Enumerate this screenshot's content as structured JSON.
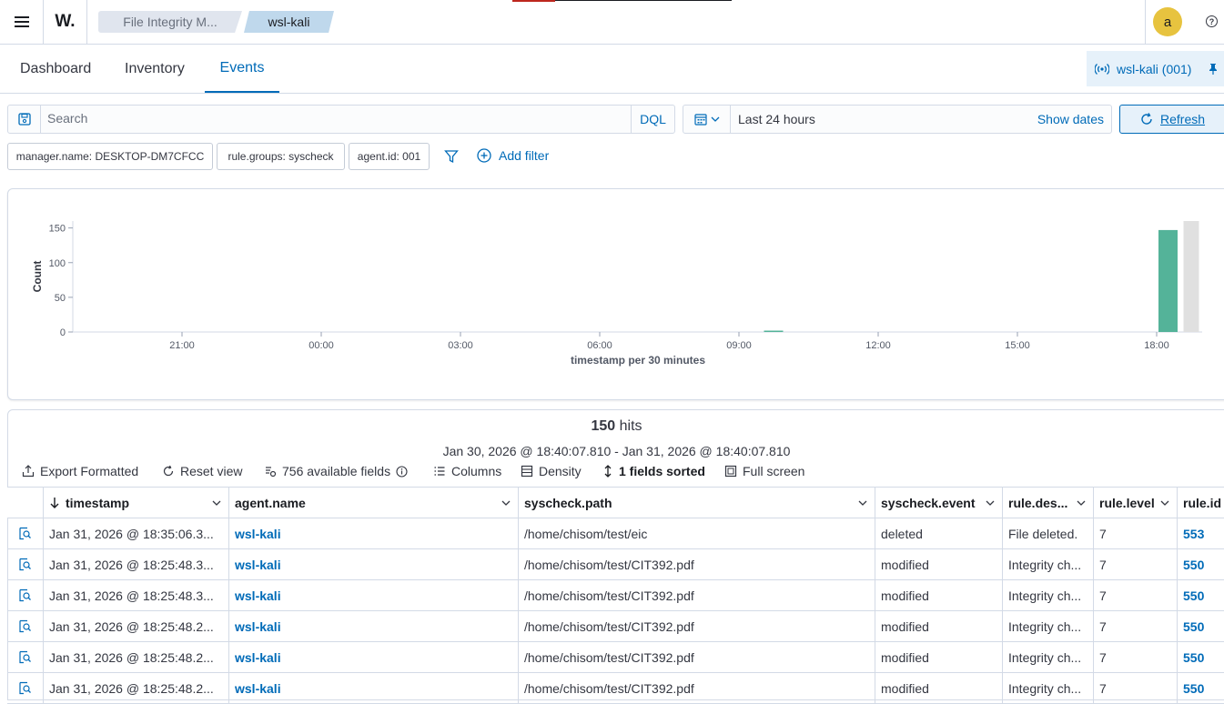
{
  "header": {
    "logo_text": "W.",
    "breadcrumbs": [
      "File Integrity M...",
      "wsl-kali"
    ],
    "avatar_initial": "a",
    "help_symbol": "?"
  },
  "nav": {
    "tabs": [
      "Dashboard",
      "Inventory",
      "Events"
    ],
    "active_tab": "Events",
    "agent_pill": "wsl-kali (001)"
  },
  "search": {
    "placeholder": "Search",
    "language": "DQL",
    "time_range": "Last 24 hours",
    "show_dates": "Show dates",
    "refresh": "Refresh"
  },
  "filters": {
    "pills": [
      "manager.name: DESKTOP-DM7CFCC",
      "rule.groups: syscheck",
      "agent.id: 001"
    ],
    "add_filter": "Add filter"
  },
  "chart_data": {
    "type": "bar",
    "ylabel": "Count",
    "xlabel": "timestamp per 30 minutes",
    "yticks": [
      "0",
      "50",
      "100",
      "150"
    ],
    "ylim": [
      0,
      160
    ],
    "xticks": [
      "21:00",
      "00:00",
      "03:00",
      "06:00",
      "09:00",
      "12:00",
      "15:00",
      "18:00"
    ],
    "x": [
      "09:30",
      "18:00",
      "18:30"
    ],
    "values": [
      1,
      147,
      0
    ],
    "bar_color": "#54b399",
    "highlight_color": "#e0e0e0"
  },
  "results": {
    "hits_count": "150",
    "hits_label": "hits",
    "date_range": "Jan 30, 2026 @ 18:40:07.810 - Jan 31, 2026 @ 18:40:07.810",
    "toolbar": {
      "export": "Export Formatted",
      "reset": "Reset view",
      "fields": "756 available fields",
      "columns": "Columns",
      "density": "Density",
      "sorted": "1 fields sorted",
      "fullscreen": "Full screen"
    }
  },
  "table": {
    "columns": [
      "timestamp",
      "agent.name",
      "syscheck.path",
      "syscheck.event",
      "rule.des...",
      "rule.level",
      "rule.id"
    ],
    "rows": [
      [
        "Jan 31, 2026 @ 18:35:06.3...",
        "wsl-kali",
        "/home/chisom/test/eic",
        "deleted",
        "File deleted.",
        "7",
        "553"
      ],
      [
        "Jan 31, 2026 @ 18:25:48.3...",
        "wsl-kali",
        "/home/chisom/test/CIT392.pdf",
        "modified",
        "Integrity ch...",
        "7",
        "550"
      ],
      [
        "Jan 31, 2026 @ 18:25:48.3...",
        "wsl-kali",
        "/home/chisom/test/CIT392.pdf",
        "modified",
        "Integrity ch...",
        "7",
        "550"
      ],
      [
        "Jan 31, 2026 @ 18:25:48.2...",
        "wsl-kali",
        "/home/chisom/test/CIT392.pdf",
        "modified",
        "Integrity ch...",
        "7",
        "550"
      ],
      [
        "Jan 31, 2026 @ 18:25:48.2...",
        "wsl-kali",
        "/home/chisom/test/CIT392.pdf",
        "modified",
        "Integrity ch...",
        "7",
        "550"
      ],
      [
        "Jan 31, 2026 @ 18:25:48.2...",
        "wsl-kali",
        "/home/chisom/test/CIT392.pdf",
        "modified",
        "Integrity ch...",
        "7",
        "550"
      ]
    ]
  }
}
